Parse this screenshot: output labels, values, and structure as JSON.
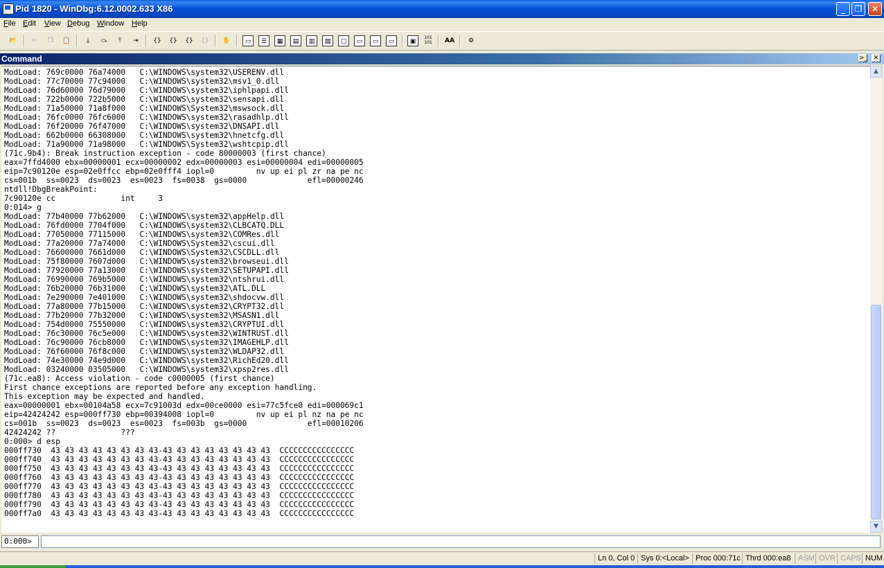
{
  "window": {
    "title": "Pid 1820 - WinDbg:6.12.0002.633 X86",
    "minimize_glyph": "_",
    "maximize_glyph": "❐",
    "close_glyph": "✕"
  },
  "menu": {
    "items": [
      {
        "ul": "F",
        "rest": "ile"
      },
      {
        "ul": "E",
        "rest": "dit"
      },
      {
        "ul": "V",
        "rest": "iew"
      },
      {
        "ul": "D",
        "rest": "ebug"
      },
      {
        "ul": "W",
        "rest": "indow"
      },
      {
        "ul": "H",
        "rest": "elp"
      }
    ]
  },
  "toolbar": {
    "glyphs": {
      "open": "📂",
      "cut": "✂",
      "copy": "❐",
      "paste": "📋",
      "step_into": "⤓",
      "step_over": "⤼",
      "step_out": "⤒",
      "run_to_cursor": "⇥",
      "go_brace1": "{}",
      "go_brace2": "{}",
      "go_brace3": "{}",
      "go_brace4": "{}",
      "hand": "✋",
      "command": "▭",
      "watch": "☰",
      "locals": "▦",
      "registers": "▤",
      "memory": "▥",
      "call_stack": "▧",
      "disassembly": "▢",
      "scratch": "▭",
      "source_mode": "▣",
      "hex_mode": "101\n101",
      "font": "AA",
      "options": "⚙"
    }
  },
  "command_window": {
    "title": "Command",
    "dock_glyph": ">_",
    "close_glyph": "✕",
    "output_lines": [
      "ModLoad: 769c0000 76a74000   C:\\WINDOWS\\system32\\USERENV.dll",
      "ModLoad: 77c70000 77c94000   C:\\WINDOWS\\system32\\msv1_0.dll",
      "ModLoad: 76d60000 76d79000   C:\\WINDOWS\\system32\\iphlpapi.dll",
      "ModLoad: 722b0000 722b5000   C:\\WINDOWS\\system32\\sensapi.dll",
      "ModLoad: 71a50000 71a8f000   C:\\WINDOWS\\System32\\mswsock.dll",
      "ModLoad: 76fc0000 76fc6000   C:\\WINDOWS\\system32\\rasadhlp.dll",
      "ModLoad: 76f20000 76f47000   C:\\WINDOWS\\system32\\DNSAPI.dll",
      "ModLoad: 662b0000 66308000   C:\\WINDOWS\\system32\\hnetcfg.dll",
      "ModLoad: 71a90000 71a98000   C:\\WINDOWS\\System32\\wshtcpip.dll",
      "(71c.9b4): Break instruction exception - code 80000003 (first chance)",
      "eax=7ffd4000 ebx=00000001 ecx=00000002 edx=00000003 esi=00000004 edi=00000005",
      "eip=7c90120e esp=02e0ffcc ebp=02e0fff4 iopl=0         nv up ei pl zr na pe nc",
      "cs=001b  ss=0023  ds=0023  es=0023  fs=0038  gs=0000             efl=00000246",
      "ntdll!DbgBreakPoint:",
      "7c90120e cc              int     3",
      "0:014> g",
      "ModLoad: 77b40000 77b62000   C:\\WINDOWS\\system32\\appHelp.dll",
      "ModLoad: 76fd0000 7704f000   C:\\WINDOWS\\system32\\CLBCATQ.DLL",
      "ModLoad: 77050000 77115000   C:\\WINDOWS\\system32\\COMRes.dll",
      "ModLoad: 77a20000 77a74000   C:\\WINDOWS\\System32\\cscui.dll",
      "ModLoad: 76600000 7661d000   C:\\WINDOWS\\System32\\CSCDLL.dll",
      "ModLoad: 75f80000 7607d000   C:\\WINDOWS\\system32\\browseui.dll",
      "ModLoad: 77920000 77a13000   C:\\WINDOWS\\system32\\SETUPAPI.dll",
      "ModLoad: 76990000 769b5000   C:\\WINDOWS\\system32\\ntshrui.dll",
      "ModLoad: 76b20000 76b31000   C:\\WINDOWS\\system32\\ATL.DLL",
      "ModLoad: 7e290000 7e401000   C:\\WINDOWS\\system32\\shdocvw.dll",
      "ModLoad: 77a80000 77b15000   C:\\WINDOWS\\system32\\CRYPT32.dll",
      "ModLoad: 77b20000 77b32000   C:\\WINDOWS\\system32\\MSASN1.dll",
      "ModLoad: 754d0000 75550000   C:\\WINDOWS\\system32\\CRYPTUI.dll",
      "ModLoad: 76c30000 76c5e000   C:\\WINDOWS\\system32\\WINTRUST.dll",
      "ModLoad: 76c90000 76cb8000   C:\\WINDOWS\\system32\\IMAGEHLP.dll",
      "ModLoad: 76f60000 76f8c000   C:\\WINDOWS\\system32\\WLDAP32.dll",
      "ModLoad: 74e30000 74e9d000   C:\\WINDOWS\\system32\\RichEd20.dll",
      "ModLoad: 03240000 03505000   C:\\WINDOWS\\system32\\xpsp2res.dll",
      "(71c.ea8): Access violation - code c0000005 (first chance)",
      "First chance exceptions are reported before any exception handling.",
      "This exception may be expected and handled.",
      "eax=00000001 ebx=00104a58 ecx=7c91003d edx=00ce0000 esi=77c5fce0 edi=000069c1",
      "eip=42424242 esp=000ff730 ebp=00394008 iopl=0         nv up ei pl nz na pe nc",
      "cs=001b  ss=0023  ds=0023  es=0023  fs=003b  gs=0000             efl=00010206",
      "42424242 ??              ???",
      "0:000> d esp",
      "000ff730  43 43 43 43 43 43 43 43-43 43 43 43 43 43 43 43  CCCCCCCCCCCCCCCC",
      "000ff740  43 43 43 43 43 43 43 43-43 43 43 43 43 43 43 43  CCCCCCCCCCCCCCCC",
      "000ff750  43 43 43 43 43 43 43 43-43 43 43 43 43 43 43 43  CCCCCCCCCCCCCCCC",
      "000ff760  43 43 43 43 43 43 43 43-43 43 43 43 43 43 43 43  CCCCCCCCCCCCCCCC",
      "000ff770  43 43 43 43 43 43 43 43-43 43 43 43 43 43 43 43  CCCCCCCCCCCCCCCC",
      "000ff780  43 43 43 43 43 43 43 43-43 43 43 43 43 43 43 43  CCCCCCCCCCCCCCCC",
      "000ff790  43 43 43 43 43 43 43 43-43 43 43 43 43 43 43 43  CCCCCCCCCCCCCCCC",
      "000ff7a0  43 43 43 43 43 43 43 43-43 43 43 43 43 43 43 43  CCCCCCCCCCCCCCCC"
    ],
    "prompt": "0:000>",
    "input_value": "",
    "scroll_up_glyph": "▲",
    "scroll_down_glyph": "▼"
  },
  "status_bar": {
    "ln_col": "Ln 0, Col 0",
    "sys": "Sys 0:<Local>",
    "proc": "Proc 000:71c",
    "thrd": "Thrd 000:ea8",
    "asm": "ASM",
    "ovr": "OVR",
    "caps": "CAPS",
    "num": "NUM"
  },
  "colors": {
    "title_bar": "#0754d8",
    "command_title": "#0a246a",
    "chrome": "#ece9d8"
  }
}
